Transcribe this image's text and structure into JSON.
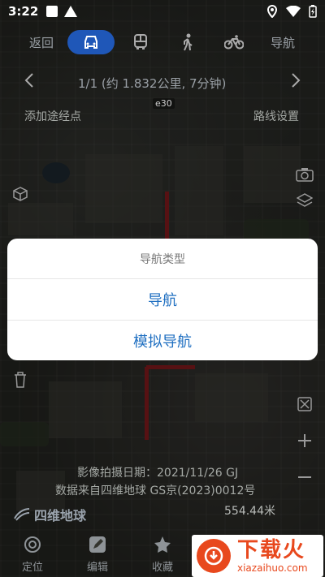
{
  "status_bar": {
    "time": "3:22",
    "icons": [
      "notification-square-icon",
      "warning-icon",
      "location-icon",
      "wifi-icon",
      "battery-icon"
    ]
  },
  "nav": {
    "back_label": "返回",
    "modes": [
      {
        "name": "car",
        "icon": "car-icon",
        "selected": true
      },
      {
        "name": "bus",
        "icon": "bus-icon",
        "selected": false
      },
      {
        "name": "walk",
        "icon": "walk-icon",
        "selected": false
      },
      {
        "name": "bike",
        "icon": "bike-icon",
        "selected": false
      }
    ],
    "navigate_label": "导航"
  },
  "route": {
    "summary": "1/1  (约 1.832公里, 7分钟)"
  },
  "map": {
    "add_waypoint": "添加途经点",
    "route_settings": "路线设置",
    "road_label": "e30"
  },
  "dialog": {
    "title": "导航类型",
    "options": [
      "导航",
      "模拟导航"
    ]
  },
  "map_info": {
    "photo_date": "影像拍摄日期：2021/11/26 GJ",
    "source": "数据来自四维地球 GS京(2023)0012号",
    "logo_text": "四维地球",
    "scale": "554.44米"
  },
  "bottom_tabs": [
    {
      "label": "定位",
      "icon": "locate-icon"
    },
    {
      "label": "编辑",
      "icon": "edit-icon"
    },
    {
      "label": "收藏",
      "icon": "star-icon"
    }
  ],
  "watermark": {
    "title": "下载火",
    "url": "xiazaihuo.com"
  },
  "colors": {
    "accent": "#1f57b8",
    "dialog_option": "#1f6fc1",
    "route": "#c0262b",
    "watermark": "#e8481d"
  }
}
